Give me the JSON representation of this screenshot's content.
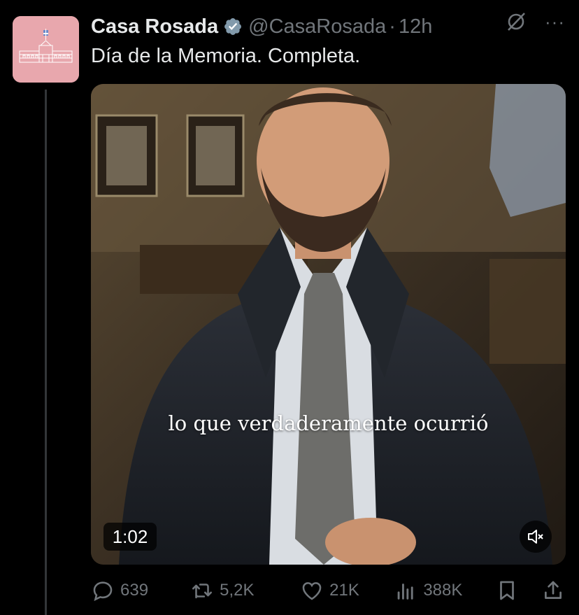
{
  "tweet": {
    "author_name": "Casa Rosada",
    "handle": "@CasaRosada",
    "separator": "·",
    "time": "12h",
    "text": "Día de la Memoria. Completa."
  },
  "icons": {
    "verified": "verified-badge-icon",
    "grok": "grok-slash-icon",
    "more": "more-dots-icon",
    "reply": "reply-icon",
    "retweet": "retweet-icon",
    "like": "heart-icon",
    "views": "views-chart-icon",
    "bookmark": "bookmark-icon",
    "share": "share-icon",
    "mute": "speaker-muted-icon"
  },
  "header": {
    "more_label": "···"
  },
  "media": {
    "caption": "lo que verdaderamente ocurrió",
    "duration": "1:02"
  },
  "actions": {
    "replies": "639",
    "retweets": "5,2K",
    "likes": "21K",
    "views": "388K"
  },
  "colors": {
    "background": "#000000",
    "text_primary": "#e7e9ea",
    "text_secondary": "#71767b",
    "verified_badge": "#829aab",
    "avatar_bg": "#e8a7ad"
  }
}
